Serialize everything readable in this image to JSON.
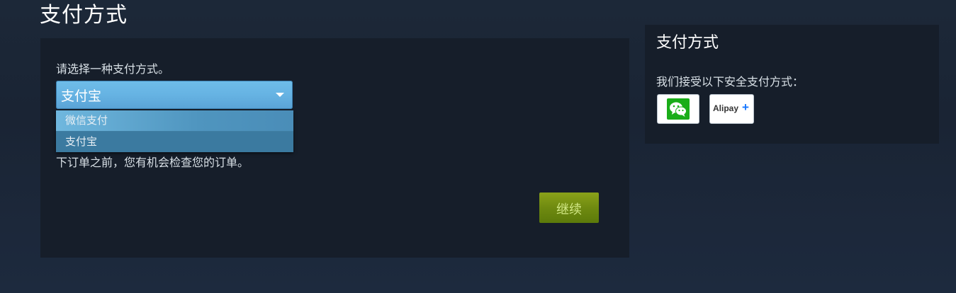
{
  "page": {
    "title": "支付方式"
  },
  "payment_form": {
    "prompt": "请选择一种支付方式。",
    "select": {
      "selected_value": "支付宝",
      "options": [
        "微信支付",
        "支付宝"
      ]
    },
    "order_note": "下订单之前，您有机会检查您的订单。",
    "continue_label": "继续"
  },
  "sidebar": {
    "title": "支付方式",
    "description": "我们接受以下安全支付方式：",
    "logos": [
      {
        "icon": "wechat-pay-logo"
      },
      {
        "icon": "alipay-plus-logo",
        "text": "Alipay",
        "plus": "+"
      }
    ]
  },
  "colors": {
    "page_background": "#1b2738",
    "panel_background": "#161e2a",
    "select_blue": "#66b3e3",
    "dropdown_blue": "#3f7fa3",
    "continue_green": "#6f8a10",
    "continue_text": "#d2e885",
    "wechat_green": "#1aad19",
    "alipay_blue": "#1677ff"
  }
}
